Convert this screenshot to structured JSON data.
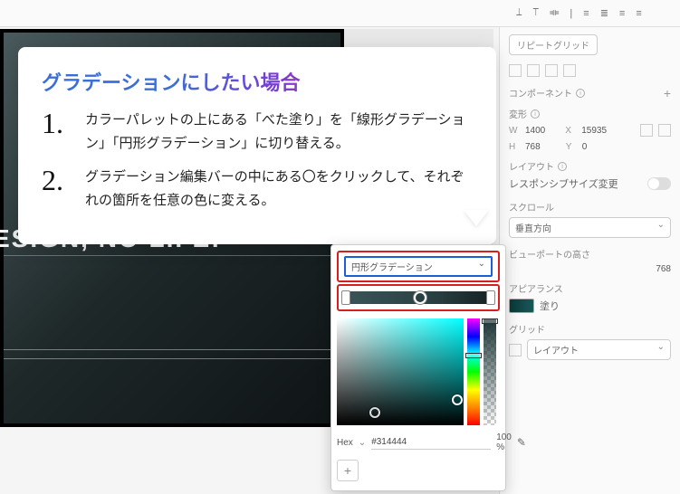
{
  "toolbar": {
    "align_icons": [
      "⟘",
      "⟙",
      "⟚",
      "|",
      "≡",
      "≣",
      "≡",
      "≡"
    ],
    "repeat_grid_label": "リピートグリッド"
  },
  "artboard": {
    "headline": "ESIGN, NO LIFE!"
  },
  "callout": {
    "title": "グラデーションにしたい場合",
    "items": [
      {
        "num": "1.",
        "text": "カラーパレットの上にある「べた塗り」を「線形グラデーション」「円形グラデーション」に切り替える。"
      },
      {
        "num": "2.",
        "text": "グラデーション編集バーの中にある〇をクリックして、それぞれの箇所を任意の色に変える。"
      }
    ]
  },
  "picker": {
    "fill_type": "円形グラデーション",
    "hex_label": "Hex",
    "hex_value": "#314444",
    "opacity": "100 %"
  },
  "panel": {
    "component_label": "コンポーネント",
    "transform_label": "変形",
    "w_label": "W",
    "w_value": "1400",
    "x_label": "X",
    "x_value": "15935",
    "h_label": "H",
    "h_value": "768",
    "y_label": "Y",
    "y_value": "0",
    "layout_label": "レイアウト",
    "responsive_label": "レスポンシブサイズ変更",
    "scroll_label": "スクロール",
    "scroll_value": "垂直方向",
    "viewport_label": "ビューポートの高さ",
    "viewport_value": "768",
    "appearance_label": "アピアランス",
    "fill_label": "塗り",
    "grid_label": "グリッド",
    "grid_value": "レイアウト"
  }
}
